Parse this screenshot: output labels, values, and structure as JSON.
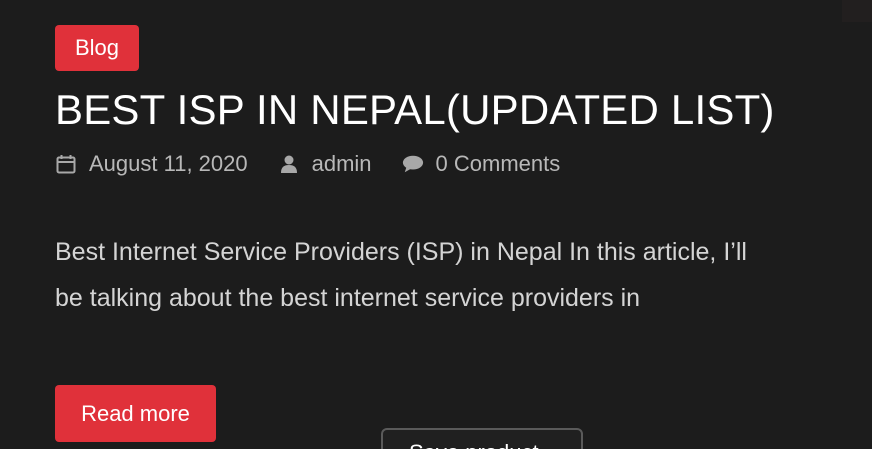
{
  "post": {
    "category": "Blog",
    "title": "BEST ISP IN NEPAL(UPDATED LIST)",
    "meta": {
      "date": "August 11, 2020",
      "date_icon": "calendar-icon",
      "author": "admin",
      "author_icon": "user-icon",
      "comments": "0 Comments",
      "comments_icon": "comment-bubble-icon"
    },
    "excerpt": "Best Internet Service Providers (ISP) in Nepal In this article, I’ll be talking about the best internet service providers in",
    "read_more_label": "Read more"
  },
  "popup": {
    "label": "Save product"
  },
  "colors": {
    "background": "#1c1c1c",
    "accent": "#e0313a",
    "meta_text": "#b8b8b8",
    "body_text": "#d4d4d4"
  }
}
